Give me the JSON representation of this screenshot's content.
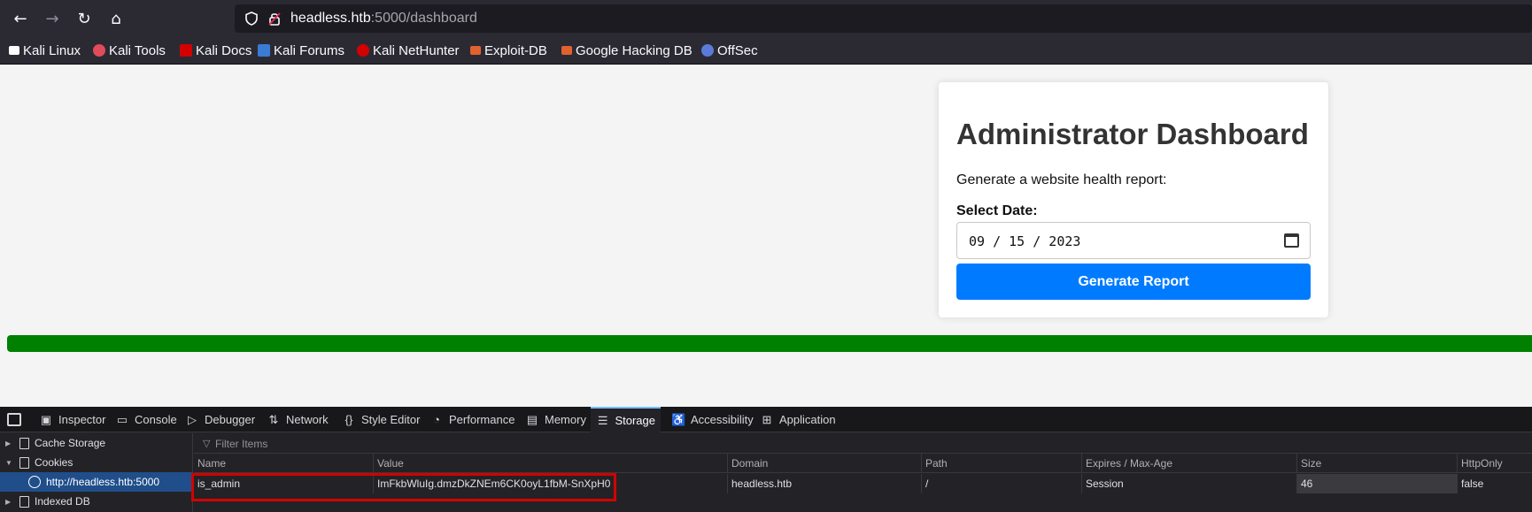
{
  "browser": {
    "url_host": "headless.htb",
    "url_path": ":5000/dashboard",
    "bookmarks": [
      {
        "label": "Kali Linux",
        "color": "#ffffff"
      },
      {
        "label": "Kali Tools",
        "color": "#e14b5a"
      },
      {
        "label": "Kali Docs",
        "color": "#d40000"
      },
      {
        "label": "Kali Forums",
        "color": "#3a7bd5"
      },
      {
        "label": "Kali NetHunter",
        "color": "#d40000"
      },
      {
        "label": "Exploit-DB",
        "color": "#e0622f"
      },
      {
        "label": "Google Hacking DB",
        "color": "#e0622f"
      },
      {
        "label": "OffSec",
        "color": "#5b7bd8"
      }
    ]
  },
  "page": {
    "title": "Administrator Dashboard",
    "description": "Generate a website health report:",
    "date_label": "Select Date:",
    "date_value": "09 / 15 / 2023",
    "button_label": "Generate Report",
    "progress_percent": 100,
    "progress_color": "#008000",
    "button_color": "#007bff"
  },
  "devtools": {
    "tabs": [
      {
        "label": "Inspector",
        "icon": "inspector-icon"
      },
      {
        "label": "Console",
        "icon": "console-icon"
      },
      {
        "label": "Debugger",
        "icon": "debugger-icon"
      },
      {
        "label": "Network",
        "icon": "network-icon"
      },
      {
        "label": "Style Editor",
        "icon": "style-editor-icon"
      },
      {
        "label": "Performance",
        "icon": "performance-icon"
      },
      {
        "label": "Memory",
        "icon": "memory-icon"
      },
      {
        "label": "Storage",
        "icon": "storage-icon",
        "active": true
      },
      {
        "label": "Accessibility",
        "icon": "accessibility-icon"
      },
      {
        "label": "Application",
        "icon": "application-icon"
      }
    ],
    "sidebar": {
      "cache_storage": "Cache Storage",
      "cookies": "Cookies",
      "cookie_host": "http://headless.htb:5000",
      "indexed_db": "Indexed DB"
    },
    "filter_placeholder": "Filter Items",
    "columns": [
      "Name",
      "Value",
      "Domain",
      "Path",
      "Expires / Max-Age",
      "Size",
      "HttpOnly"
    ],
    "rows": [
      {
        "name": "is_admin",
        "value": "ImFkbWluIg.dmzDkZNEm6CK0oyL1fbM-SnXpH0",
        "domain": "headless.htb",
        "path": "/",
        "expires": "Session",
        "size": "46",
        "httponly": "false"
      }
    ]
  }
}
